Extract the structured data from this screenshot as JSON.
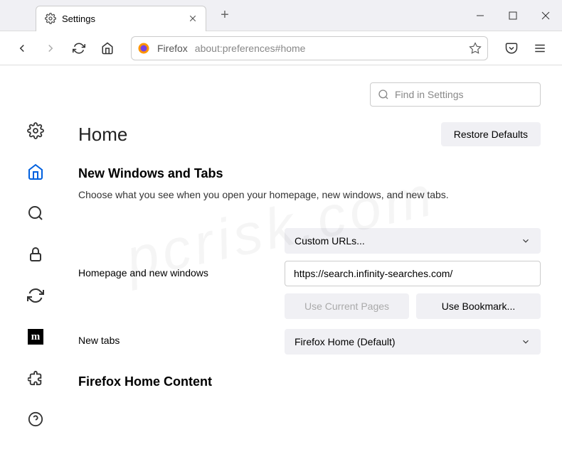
{
  "tab": {
    "title": "Settings"
  },
  "urlbar": {
    "label": "Firefox",
    "url": "about:preferences#home"
  },
  "search": {
    "placeholder": "Find in Settings"
  },
  "header": {
    "title": "Home",
    "restore_label": "Restore Defaults"
  },
  "section1": {
    "title": "New Windows and Tabs",
    "desc": "Choose what you see when you open your homepage, new windows, and new tabs."
  },
  "homepage": {
    "label": "Homepage and new windows",
    "dropdown": "Custom URLs...",
    "url_value": "https://search.infinity-searches.com/",
    "use_current": "Use Current Pages",
    "use_bookmark": "Use Bookmark..."
  },
  "newtabs": {
    "label": "New tabs",
    "dropdown": "Firefox Home (Default)"
  },
  "section2": {
    "title": "Firefox Home Content"
  }
}
